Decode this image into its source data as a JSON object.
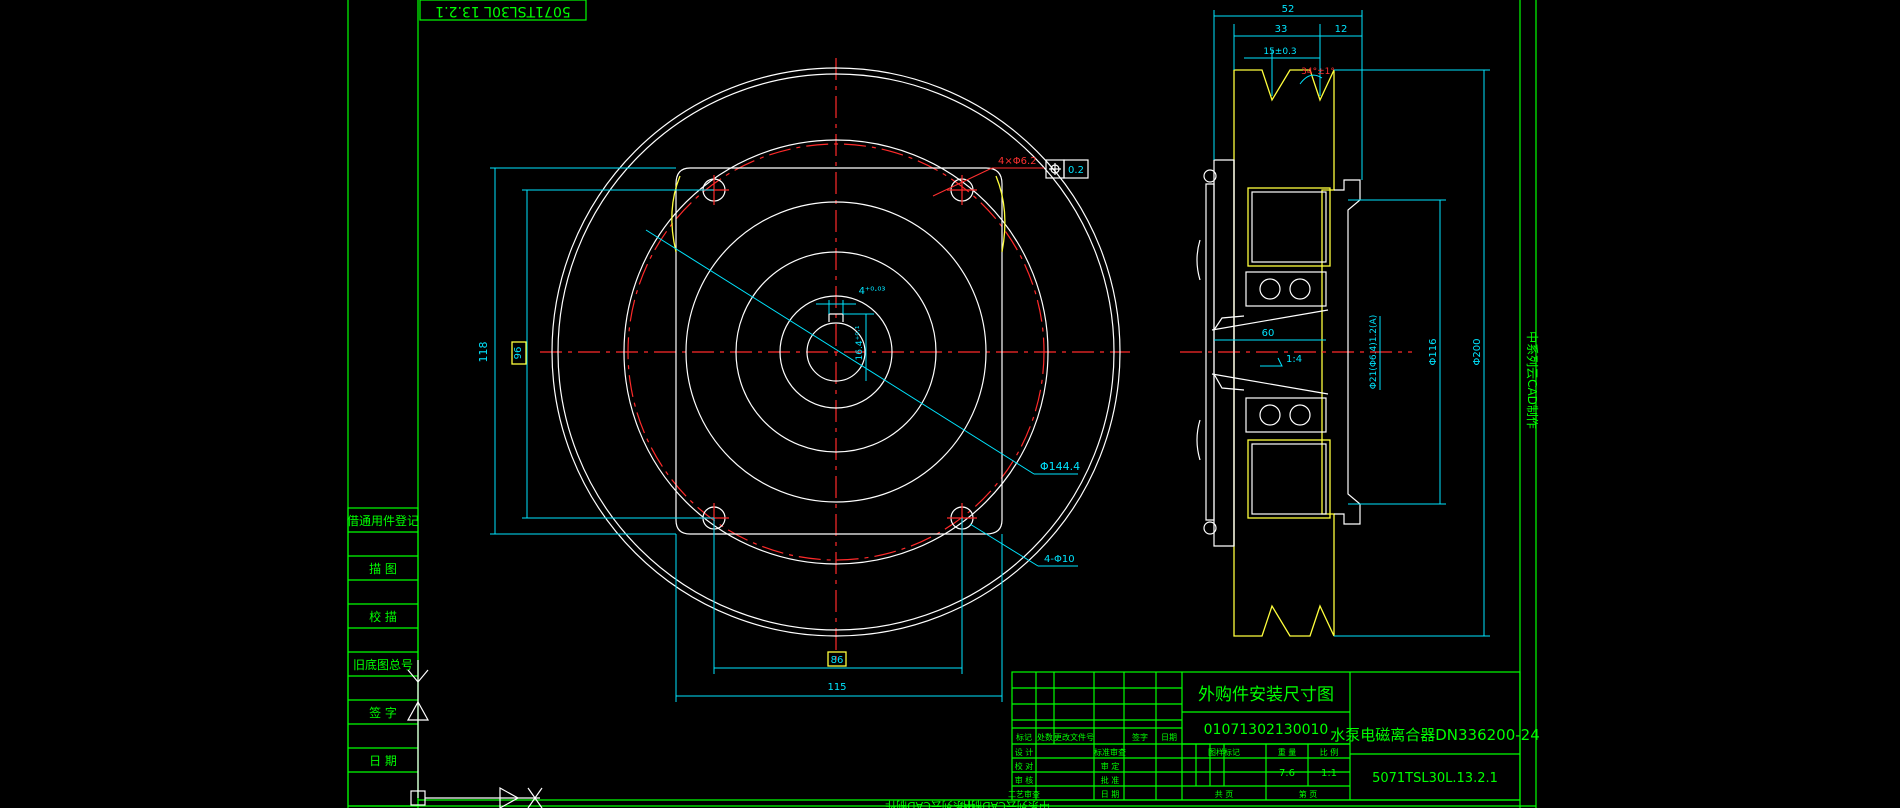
{
  "colors": {
    "frame": "#00ff00",
    "outline": "#ffffff",
    "centerline": "#ff2a2a",
    "dimension": "#00e5ff",
    "section": "#ffff3c",
    "hatch": "#6b6b00"
  },
  "top_stamp": "5071TSL30L 13.2.1",
  "side_caption": "中系列云CAD制作",
  "bottom_stamp": "中系列云CAD制作",
  "left_strip": {
    "labels": [
      "借通用件登记",
      "描 图",
      "校 描",
      "旧底图总号",
      "签 字",
      "日 期"
    ]
  },
  "front_view_dims": {
    "holes_top": "4×Φ6.2",
    "tol_box": "0.2",
    "key_top": "4⁺⁰·⁰³",
    "key_side": "16.4⁺⁰·¹",
    "pcd": "Φ144.4",
    "holes_bottom": "4-Φ10",
    "height_outer": "118",
    "height_inner": "96",
    "width_inner": "86",
    "width_outer": "115"
  },
  "side_view_dims": {
    "overall_width": "52",
    "hub_width": "33",
    "flange_width": "12",
    "groove_pitch": "15±0.3",
    "groove_angle": "34°±1°",
    "hub_len": "60",
    "taper": "1:4",
    "bore_dia": "Φ21(Φ6.4)1.2(A)",
    "hub_dia": "Φ116",
    "pulley_dia": "Φ200"
  },
  "title_block": {
    "drawing_title": "外购件安装尺寸图",
    "drawing_number": "01071302130010",
    "product_name": "水泵电磁离合器DN336200-24",
    "part_code": "5071TSL30L.13.2.1",
    "header_labels": [
      "标记",
      "处数",
      "更改文件号",
      "签字",
      "日期"
    ],
    "row_labels": [
      "设 计",
      "校 对",
      "审 核",
      "工艺审查"
    ],
    "mid_labels": [
      "标准审查",
      "审 定",
      "批 准",
      "日 期"
    ],
    "stage_label": "图样标记",
    "weight_label": "重 量",
    "scale_label": "比 例",
    "weight_value": "7.6",
    "scale_value": "1:1",
    "sheet_total": "共 页",
    "sheet_no": "第 页"
  }
}
